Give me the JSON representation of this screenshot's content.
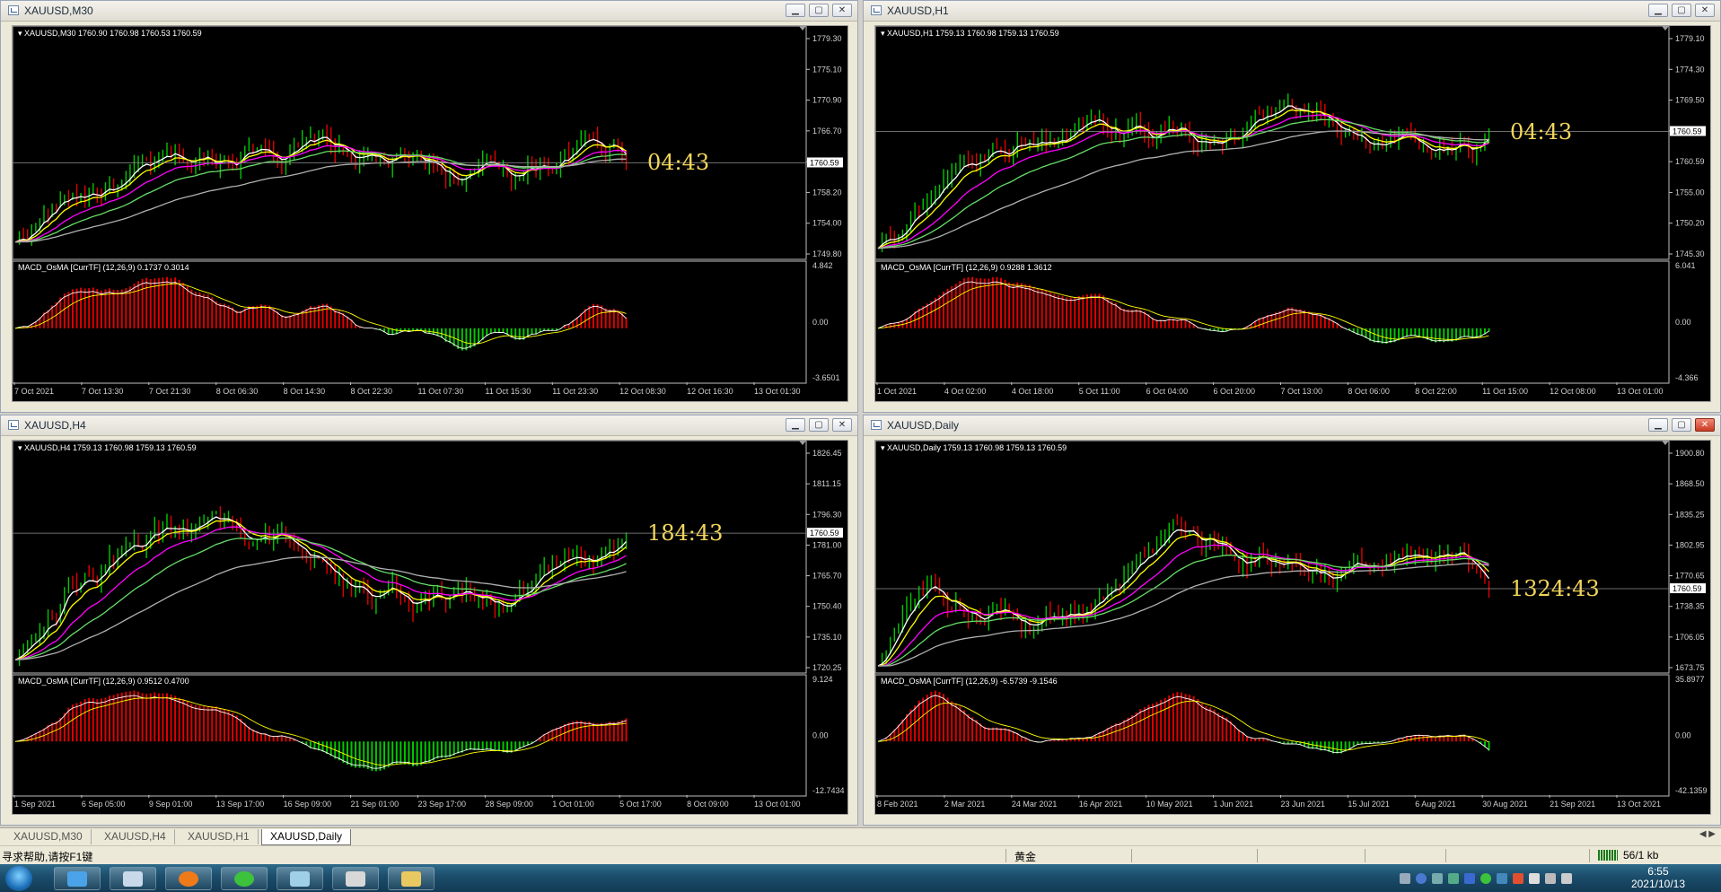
{
  "windows": [
    {
      "id": "m30",
      "title": "XAUUSD,M30",
      "info": "XAUUSD,M30  1760.90 1760.98 1760.53 1760.59",
      "macd": "MACD_OsMA [CurrTF] (12,26,9) 0.1737 0.3014",
      "timer": "04:43",
      "prices": [
        "1779.30",
        "1775.10",
        "1770.90",
        "1766.70",
        "1762.50",
        "1758.20",
        "1754.00",
        "1749.80"
      ],
      "price_tag": "1760.59",
      "macd_scale": [
        "4.842",
        "0.00",
        "-3.6501"
      ],
      "dates": [
        "7 Oct 2021",
        "7 Oct 13:30",
        "7 Oct 21:30",
        "8 Oct 06:30",
        "8 Oct 14:30",
        "8 Oct 22:30",
        "11 Oct 07:30",
        "11 Oct 15:30",
        "11 Oct 23:30",
        "12 Oct 08:30",
        "12 Oct 16:30",
        "13 Oct 01:30"
      ],
      "closing": false
    },
    {
      "id": "h1",
      "title": "XAUUSD,H1",
      "info": "XAUUSD,H1  1759.13 1760.98 1759.13 1760.59",
      "macd": "MACD_OsMA [CurrTF] (12,26,9) 0.9288 1.3612",
      "timer": "04:43",
      "prices": [
        "1779.10",
        "1774.30",
        "1769.50",
        "1764.60",
        "1760.59",
        "1755.00",
        "1750.20",
        "1745.30"
      ],
      "price_tag": "1760.59",
      "macd_scale": [
        "6.041",
        "0.00",
        "-4.366"
      ],
      "dates": [
        "1 Oct 2021",
        "4 Oct 02:00",
        "4 Oct 18:00",
        "5 Oct 11:00",
        "6 Oct 04:00",
        "6 Oct 20:00",
        "7 Oct 13:00",
        "8 Oct 06:00",
        "8 Oct 22:00",
        "11 Oct 15:00",
        "12 Oct 08:00",
        "13 Oct 01:00"
      ],
      "closing": false
    },
    {
      "id": "h4",
      "title": "XAUUSD,H4",
      "info": "XAUUSD,H4  1759.13 1760.98 1759.13 1760.59",
      "macd": "MACD_OsMA [CurrTF] (12,26,9) 0.9512 0.4700",
      "timer": "184:43",
      "prices": [
        "1826.45",
        "1811.15",
        "1796.30",
        "1781.00",
        "1765.70",
        "1750.40",
        "1735.10",
        "1720.25"
      ],
      "price_tag": "1760.59",
      "macd_scale": [
        "9.124",
        "0.00",
        "-12.7434"
      ],
      "dates": [
        "1 Sep 2021",
        "6 Sep 05:00",
        "9 Sep 01:00",
        "13 Sep 17:00",
        "16 Sep 09:00",
        "21 Sep 01:00",
        "23 Sep 17:00",
        "28 Sep 09:00",
        "1 Oct 01:00",
        "5 Oct 17:00",
        "8 Oct 09:00",
        "13 Oct 01:00"
      ],
      "closing": false
    },
    {
      "id": "d1",
      "title": "XAUUSD,Daily",
      "info": "XAUUSD,Daily  1759.13 1760.98 1759.13 1760.59",
      "macd": "MACD_OsMA [CurrTF] (12,26,9) -6.5739 -9.1546",
      "timer": "1324:43",
      "prices": [
        "1900.80",
        "1868.50",
        "1835.25",
        "1802.95",
        "1770.65",
        "1738.35",
        "1706.05",
        "1673.75"
      ],
      "price_tag": "1760.59",
      "macd_scale": [
        "35.8977",
        "0.00",
        "-42.1359"
      ],
      "dates": [
        "8 Feb 2021",
        "2 Mar 2021",
        "24 Mar 2021",
        "16 Apr 2021",
        "10 May 2021",
        "1 Jun 2021",
        "23 Jun 2021",
        "15 Jul 2021",
        "6 Aug 2021",
        "30 Aug 2021",
        "21 Sep 2021",
        "13 Oct 2021"
      ],
      "closing": true
    }
  ],
  "tabs": [
    "XAUUSD,M30",
    "XAUUSD,H4",
    "XAUUSD,H1",
    "XAUUSD,Daily"
  ],
  "active_tab": 3,
  "status": {
    "help": "寻求帮助,请按F1键",
    "profile": "黄金",
    "traffic": "56/1 kb"
  },
  "taskbar": {
    "time": "6:55",
    "date": "2021/10/13"
  },
  "colors": {
    "bull": "#00c800",
    "bear": "#e00000",
    "ma_fast": "#ffffff",
    "ma_yellow": "#ffff00",
    "ma_magenta": "#ff00ff",
    "ma_green": "#66dd66",
    "ma_gray": "#b0b0b0",
    "timer": "#f2d65a"
  }
}
